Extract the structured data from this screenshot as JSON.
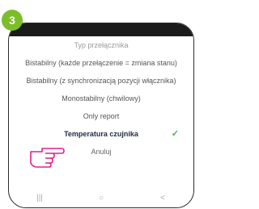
{
  "step_badge": "3",
  "dialog": {
    "title": "Typ przełącznika",
    "options": [
      "Bistabilny (każde przełączenie = zmiana stanu)",
      "Bistabilny (z synchronizacją pozycji włącznika)",
      "Monostabilny (chwilowy)",
      "Only report",
      "Temperatura czujnika"
    ],
    "selected_index": 4,
    "cancel_label": "Anuluj"
  },
  "navbar": [
    "|||",
    "○",
    "<"
  ],
  "colors": {
    "accent": "#7cbd2a",
    "check": "#4caf50"
  }
}
